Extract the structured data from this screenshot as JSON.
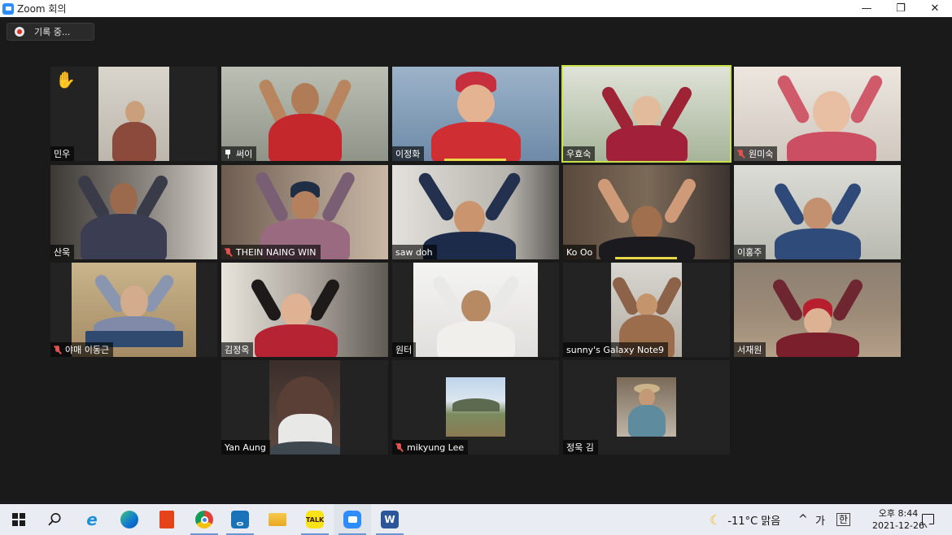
{
  "window": {
    "title": "Zoom 회의",
    "controls": [
      "—",
      "❐",
      "✕"
    ]
  },
  "recording": {
    "label": "기록 중..."
  },
  "participants": [
    {
      "name": "민우",
      "mic_muted": false,
      "raised_hand": true
    },
    {
      "name": "써이",
      "mic_muted": false,
      "pinned": true
    },
    {
      "name": "이정화",
      "mic_muted": false,
      "talking": true
    },
    {
      "name": "우효숙",
      "mic_muted": false,
      "active_speaker": true
    },
    {
      "name": "원미숙",
      "mic_muted": true
    },
    {
      "name": "산욱",
      "mic_muted": false
    },
    {
      "name": "THEIN NAING WIN",
      "mic_muted": true
    },
    {
      "name": "saw doh",
      "mic_muted": false
    },
    {
      "name": "Ko Oo",
      "mic_muted": false,
      "talking": true
    },
    {
      "name": "이홍주",
      "mic_muted": false
    },
    {
      "name": "야매 이동근",
      "mic_muted": true
    },
    {
      "name": "김정옥",
      "mic_muted": false
    },
    {
      "name": "원터",
      "mic_muted": false
    },
    {
      "name": "sunny's Galaxy Note9",
      "mic_muted": false
    },
    {
      "name": "서재원",
      "mic_muted": false
    },
    {
      "name": "Yan Aung",
      "mic_muted": false
    },
    {
      "name": "mikyung Lee",
      "mic_muted": true
    },
    {
      "name": "정욱 김",
      "mic_muted": false
    }
  ],
  "taskbar": {
    "apps": [
      "windows-start",
      "search",
      "internet-explorer",
      "edge",
      "office",
      "chrome",
      "store",
      "file-explorer",
      "kakaotalk",
      "zoom",
      "word"
    ],
    "kakao_label": "TALK",
    "weather": "-11°C 맑음",
    "ime_lang": "가",
    "ime_mode": "한",
    "chevron": "^",
    "time": "오후 8:44",
    "date": "2021-12-26"
  },
  "colors": {
    "background": "#1a1a1a",
    "speaker_border": "#c9e24a",
    "muted_icon": "#e25050",
    "zoom_blue": "#2d8cff"
  }
}
